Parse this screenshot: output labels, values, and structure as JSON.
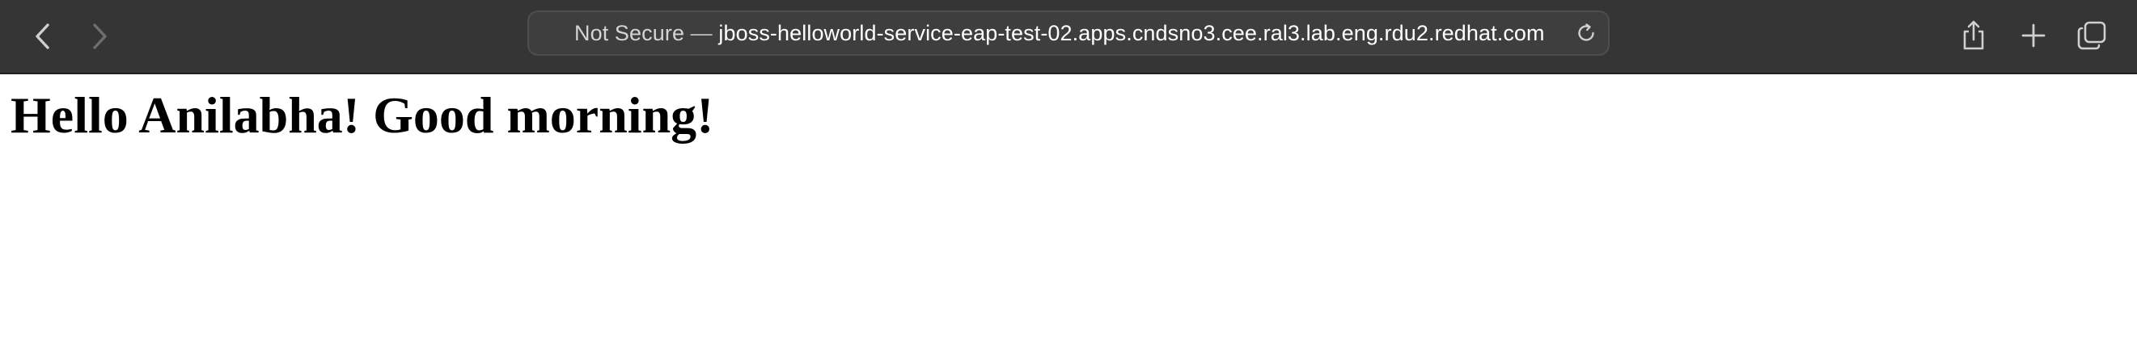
{
  "toolbar": {
    "address": {
      "security_label": "Not Secure",
      "separator": " — ",
      "host": "jboss-helloworld-service-eap-test-02.apps.cndsno3.cee.ral3.lab.eng.rdu2.redhat.com"
    },
    "icons": {
      "back": "chevron-left-icon",
      "forward": "chevron-right-icon",
      "reload": "reload-icon",
      "share": "share-icon",
      "new_tab": "plus-icon",
      "tabs": "tabs-overview-icon"
    },
    "colors": {
      "background": "#353535",
      "address_bar": "#3e3e3e"
    }
  },
  "page": {
    "heading": "Hello Anilabha! Good morning!"
  }
}
